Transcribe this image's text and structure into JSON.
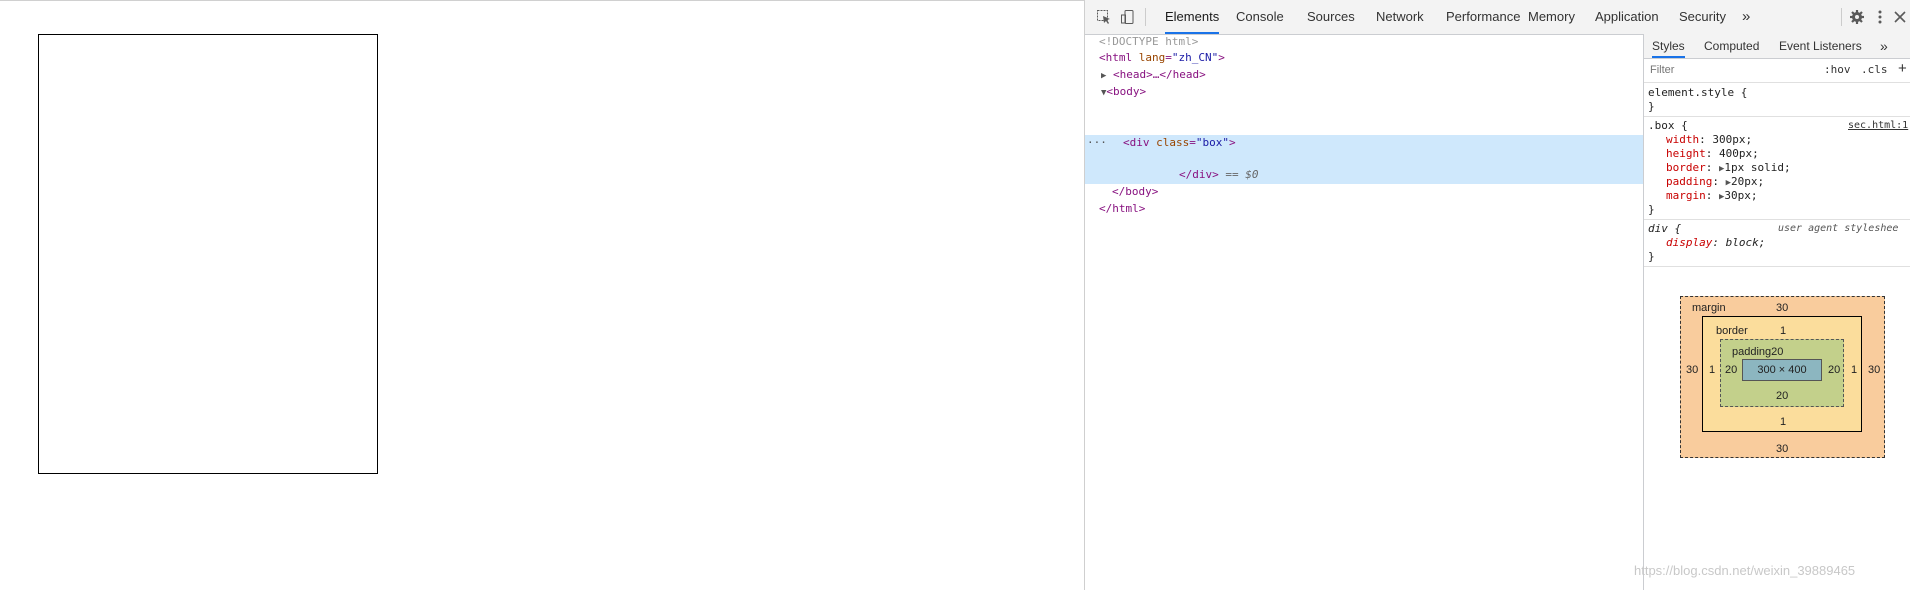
{
  "devtools": {
    "tabs": [
      "Elements",
      "Console",
      "Sources",
      "Network",
      "Performance",
      "Memory",
      "Application",
      "Security"
    ],
    "more_glyph": "»",
    "elements_tree": {
      "doctype": "<!DOCTYPE html>",
      "html_open_tag": "html",
      "html_attr": "lang",
      "html_attr_val": "\"zh_CN\"",
      "head_collapsed": "<head>…</head>",
      "body_open": "<body>",
      "div_tag": "div",
      "div_attr": "class",
      "div_attr_val": "\"box\"",
      "div_close": "</div>",
      "selected_marker": "== $0",
      "body_close": "</body>",
      "html_close": "</html>",
      "ellipsis": "···"
    },
    "styles_pane": {
      "tabs": [
        "Styles",
        "Computed",
        "Event Listeners"
      ],
      "more_glyph": "»",
      "filter_placeholder": "Filter",
      "hov": ":hov",
      "cls": ".cls",
      "plus": "+",
      "element_style": "element.style {",
      "close_brace": "}",
      "box_rule": {
        "selector": ".box {",
        "source": "sec.html:1",
        "declarations": [
          {
            "name": "width",
            "value": "300px;"
          },
          {
            "name": "height",
            "value": "400px;"
          },
          {
            "name": "border",
            "value": "1px solid;"
          },
          {
            "name": "padding",
            "value": "20px;"
          },
          {
            "name": "margin",
            "value": "30px;"
          }
        ]
      },
      "div_rule": {
        "selector": "div {",
        "source": "user agent styleshee",
        "declarations": [
          {
            "name": "display",
            "value": "block;"
          }
        ]
      }
    },
    "box_model": {
      "margin_label": "margin",
      "margin_top": "30",
      "margin_bottom": "30",
      "margin_left": "30",
      "margin_right": "30",
      "border_label": "border",
      "border_top": "1",
      "border_bottom": "1",
      "border_left": "1",
      "border_right": "1",
      "padding_label": "padding20",
      "padding_bottom": "20",
      "padding_left": "20",
      "padding_right": "20",
      "content": "300 × 400"
    }
  },
  "watermark": "https://blog.csdn.net/weixin_39889465"
}
